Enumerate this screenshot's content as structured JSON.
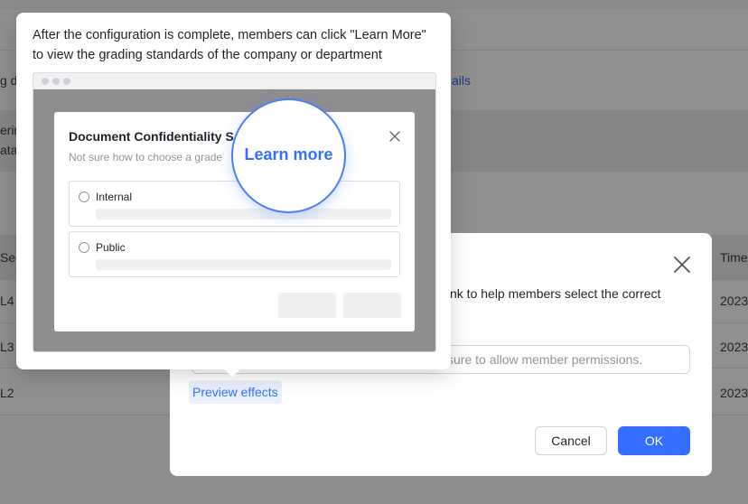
{
  "background": {
    "fragments": [
      "g d",
      "ails",
      "erin",
      "ata",
      "Sec",
      "Time",
      "L4",
      "L3",
      "L2",
      "2023",
      "2023",
      "2023"
    ]
  },
  "dialog": {
    "description_fragment": "nk to help members select the correct",
    "input_placeholder": "sure to allow member permissions.",
    "preview_link": "Preview effects",
    "cancel_label": "Cancel",
    "ok_label": "OK",
    "close_icon": "close-icon"
  },
  "popover": {
    "text": "After the configuration is complete, members can click \"Learn More\" to view the grading standards of the company or department",
    "mock": {
      "title": "Document Confidentiality S",
      "subtitle": "Not sure how to choose a grade",
      "options": [
        {
          "label": "Internal"
        },
        {
          "label": "Public"
        }
      ]
    },
    "magnifier_text": "Learn more"
  },
  "colors": {
    "accent": "#3370ff",
    "overlay": "#8d8d8d"
  }
}
